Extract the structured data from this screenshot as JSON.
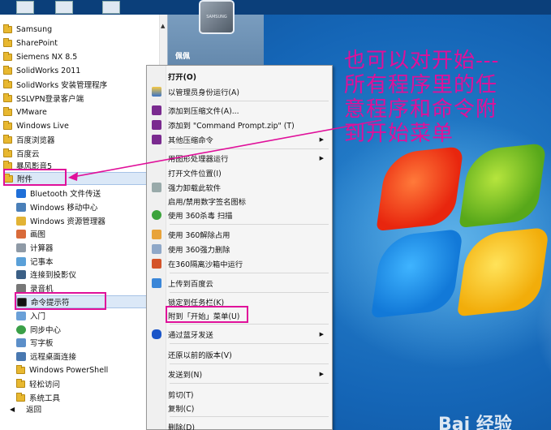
{
  "colors": {
    "annotation": "#e0109a",
    "menu_bg": "#f5f5f5"
  },
  "user": {
    "name": "佩佩",
    "avatar_text": "SAMSUNG"
  },
  "programs": {
    "folders_top": [
      "Samsung",
      "SharePoint",
      "Siemens NX 8.5",
      "SolidWorks 2011",
      "SolidWorks 安装管理程序",
      "SSLVPN登录客户端",
      "VMware",
      "Windows Live",
      "百度浏览器",
      "百度云",
      "暴风影音5"
    ],
    "accessories_label": "附件",
    "accessories_items": [
      "Bluetooth 文件传送",
      "Windows 移动中心",
      "Windows 资源管理器",
      "画图",
      "计算器",
      "记事本",
      "连接到投影仪",
      "录音机"
    ],
    "cmd_label": "命令提示符",
    "accessories_items_after": [
      "入门",
      "同步中心",
      "写字板",
      "远程桌面连接",
      "Windows PowerShell"
    ],
    "folders_after": [
      "轻松访问",
      "系统工具"
    ],
    "back_label": "返回"
  },
  "context_menu": {
    "open": "打开(O)",
    "run_as_admin": "以管理员身份运行(A)",
    "add_archive": "添加到压缩文件(A)...",
    "add_zip": "添加到 \"Command Prompt.zip\" (T)",
    "other_compress": "其他压缩命令",
    "run_graphics": "用图形处理器运行",
    "open_location": "打开文件位置(I)",
    "force_uninstall": "强力卸载此软件",
    "toggle_sig_icon": "启用/禁用数字签名图标",
    "scan_360": "使用 360杀毒 扫描",
    "unlock_360": "使用 360解除占用",
    "delete_360": "使用 360强力删除",
    "sandbox_360": "在360隔离沙箱中运行",
    "upload_baidu": "上传到百度云",
    "pin_taskbar": "锁定到任务栏(K)",
    "pin_start": "附到「开始」菜单(U)",
    "bluetooth_send": "通过蓝牙发送",
    "restore_prev": "还原以前的版本(V)",
    "send_to": "发送到(N)",
    "cut": "剪切(T)",
    "copy": "复制(C)",
    "delete": "删除(D)"
  },
  "annotation": {
    "line1": "也可以对开始---",
    "line2": "所有程序里的任",
    "line3": "意程序和命令附",
    "line4": "到开始菜单"
  },
  "watermark": "Bai 经验"
}
